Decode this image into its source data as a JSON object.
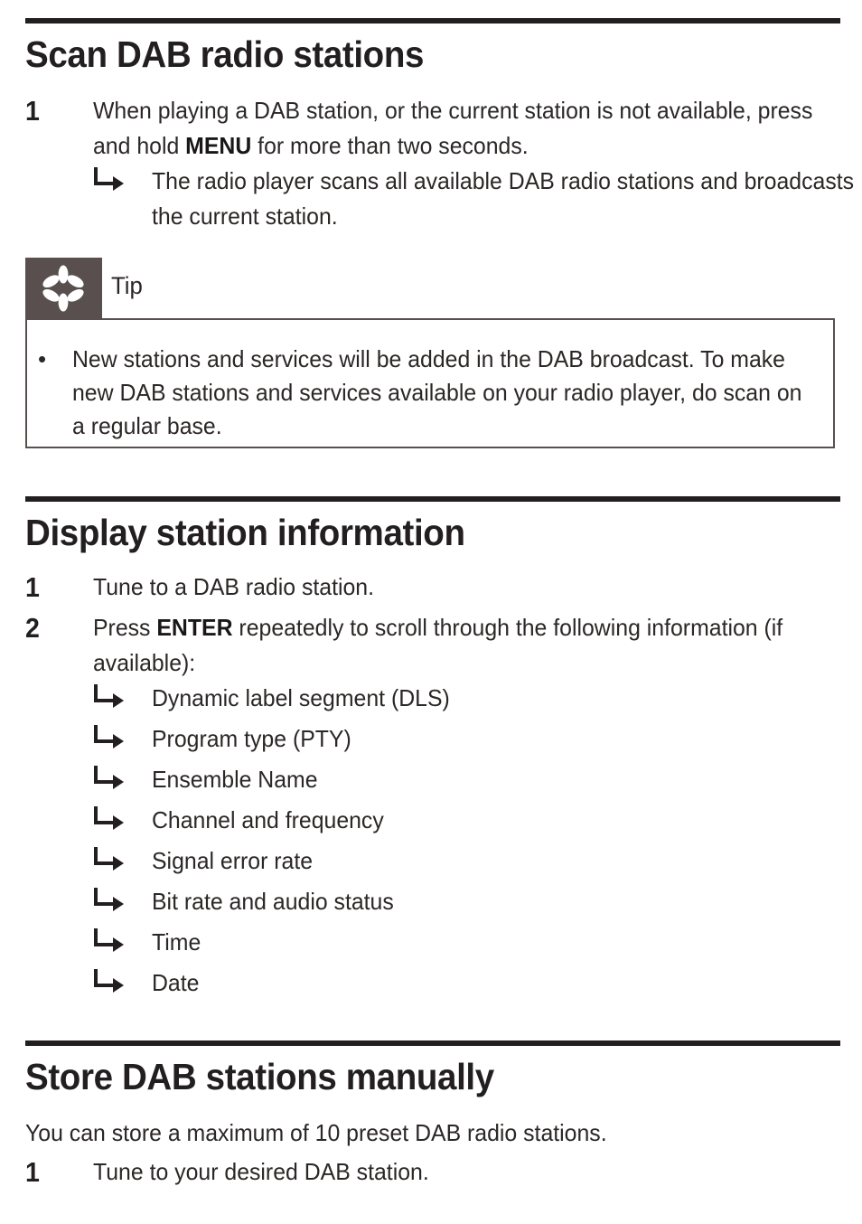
{
  "sections": [
    {
      "id": "scan",
      "heading": "Scan DAB radio stations",
      "steps": [
        {
          "number": "1",
          "text_before": "When playing a DAB station, or the current station is not available, press and hold ",
          "emphasis": "MENU",
          "text_after": " for more than two seconds."
        }
      ],
      "subitems": [
        "The radio player scans all available DAB radio stations and broadcasts the current station."
      ]
    },
    {
      "id": "display",
      "heading": "Display station information",
      "steps": [
        {
          "number": "1",
          "text_before": "Tune to a DAB radio station.",
          "emphasis": "",
          "text_after": ""
        },
        {
          "number": "2",
          "text_before": "Press ",
          "emphasis": "ENTER",
          "text_after": " repeatedly to scroll through the following information (if available):"
        }
      ],
      "subitems": [
        "Dynamic label segment (DLS)",
        "Program type (PTY)",
        "Ensemble Name",
        "Channel and frequency",
        "Signal error rate",
        "Bit rate and audio status",
        "Time",
        "Date"
      ]
    },
    {
      "id": "store",
      "heading": "Store DAB stations manually",
      "intro": "You can store a maximum of 10 preset DAB radio stations.",
      "steps": [
        {
          "number": "1",
          "text_before": "Tune to your desired DAB station.",
          "emphasis": "",
          "text_after": ""
        }
      ],
      "subitems": []
    }
  ],
  "tip": {
    "label": "Tip",
    "icon": "asterisk-flower-icon",
    "bullet_marker": "•",
    "bullet_text": "New stations and services will be added in the DAB broadcast. To make new DAB stations and services available on your radio player, do scan on a regular base.",
    "header_bg_color": "#584f4e",
    "border_color": "#58504f"
  },
  "sub_marker": "↳",
  "colors": {
    "rule": "#231f20",
    "text": "#2b2726",
    "page_bg": "#ffffff"
  }
}
